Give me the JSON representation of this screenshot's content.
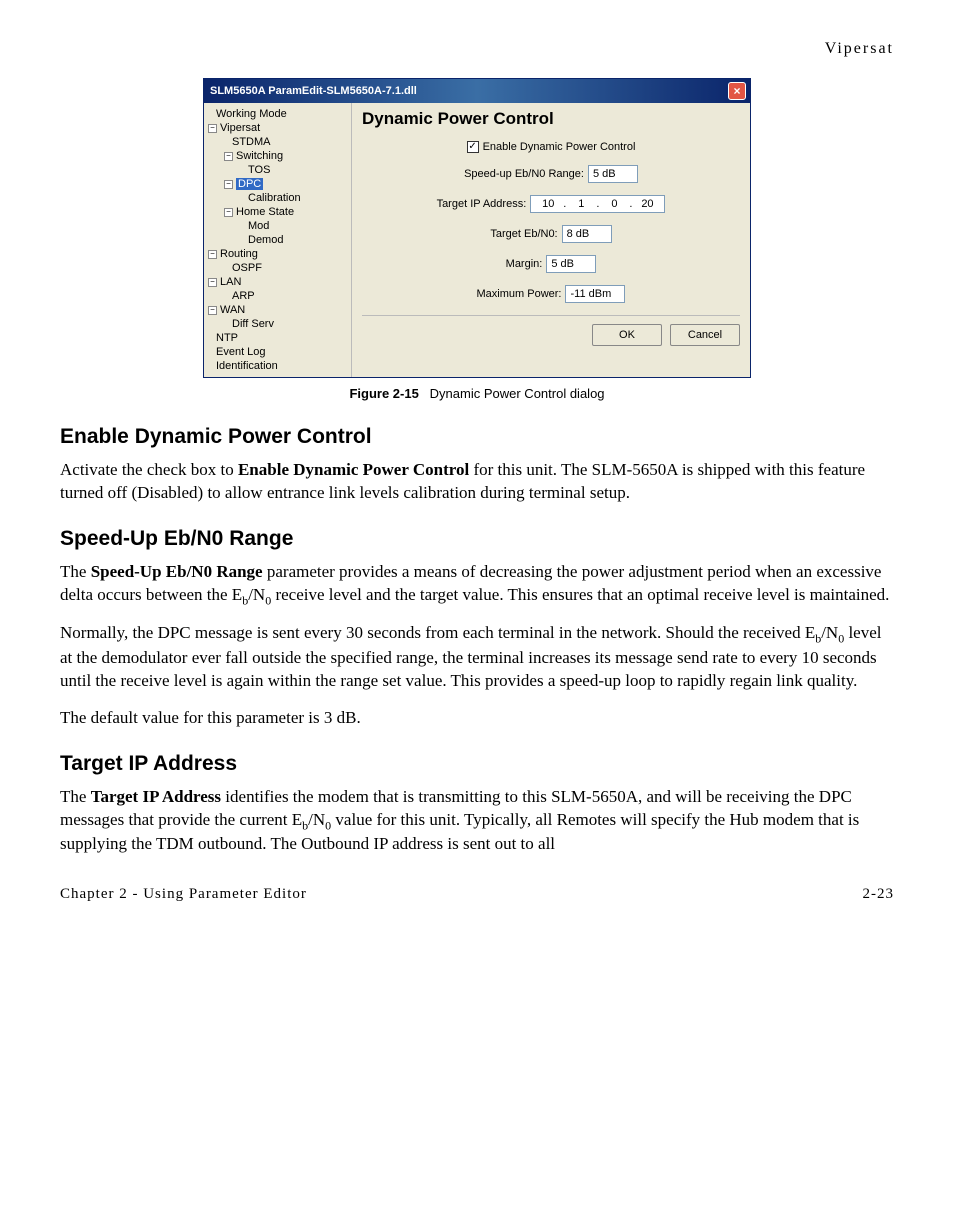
{
  "header": {
    "product": "Vipersat"
  },
  "dialog": {
    "title": "SLM5650A ParamEdit-SLM5650A-7.1.dll",
    "tree": {
      "working_mode": "Working Mode",
      "vipersat": "Vipersat",
      "stdma": "STDMA",
      "switching": "Switching",
      "tos": "TOS",
      "dpc": "DPC",
      "calibration": "Calibration",
      "home_state": "Home State",
      "mod": "Mod",
      "demod": "Demod",
      "routing": "Routing",
      "ospf": "OSPF",
      "lan": "LAN",
      "arp": "ARP",
      "wan": "WAN",
      "diffserv": "Diff Serv",
      "ntp": "NTP",
      "eventlog": "Event Log",
      "identification": "Identification"
    },
    "panel": {
      "title": "Dynamic Power Control",
      "enable_label": "Enable Dynamic Power Control",
      "enable_checked": true,
      "speedup_label": "Speed-up Eb/N0 Range:",
      "speedup_value": "5 dB",
      "targetip_label": "Target IP Address:",
      "targetip_segs": [
        "10",
        "1",
        "0",
        "20"
      ],
      "targetebn0_label": "Target Eb/N0:",
      "targetebn0_value": "8 dB",
      "margin_label": "Margin:",
      "margin_value": "5 dB",
      "maxpower_label": "Maximum Power:",
      "maxpower_value": "-11 dBm",
      "ok": "OK",
      "cancel": "Cancel"
    }
  },
  "caption": {
    "label": "Figure 2-15",
    "text": "Dynamic Power Control dialog"
  },
  "sections": {
    "s1_title": "Enable Dynamic Power Control",
    "s1_p1a": "Activate the check box to ",
    "s1_p1b": "Enable Dynamic Power Control",
    "s1_p1c": " for this unit. The SLM-5650A is shipped with this feature turned off (Disabled) to allow entrance link levels calibration during terminal setup.",
    "s2_title": "Speed-Up Eb/N0 Range",
    "s2_p1a": "The ",
    "s2_p1b": "Speed-Up Eb/N0 Range",
    "s2_p1c": " parameter provides a means of decreasing the power adjustment period when an excessive delta occurs between the E",
    "s2_p1d": "/N",
    "s2_p1e": " receive level and the target value. This ensures that an optimal receive level is maintained.",
    "s2_p2a": "Normally, the DPC message is sent every 30 seconds from each terminal in the network. Should the received E",
    "s2_p2b": "/N",
    "s2_p2c": " level at the demodulator ever fall outside the specified range, the terminal increases its message send rate to every 10 seconds until the receive level is again within the range set value. This provides a speed-up loop to rapidly regain link quality.",
    "s2_p3": "The default value for this parameter is 3 dB.",
    "s3_title": "Target IP Address",
    "s3_p1a": "The ",
    "s3_p1b": "Target IP Address",
    "s3_p1c": " identifies the modem that is transmitting to this SLM-5650A, and will be receiving the DPC messages that provide the current E",
    "s3_p1d": "/N",
    "s3_p1e": " value for this unit. Typically, all Remotes will specify the Hub modem that is supplying the TDM outbound. The Outbound IP address is sent out to all"
  },
  "footer": {
    "left": "Chapter 2 - Using Parameter Editor",
    "right": "2-23"
  }
}
